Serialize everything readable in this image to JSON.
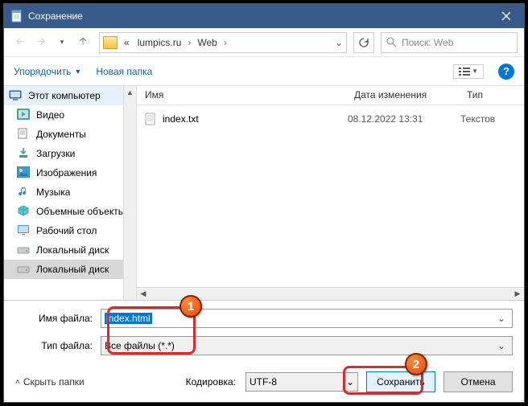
{
  "title": "Сохранение",
  "breadcrumb": {
    "prefix": "«",
    "part1": "lumpics.ru",
    "part2": "Web"
  },
  "search": {
    "placeholder": "Поиск: Web"
  },
  "toolbar": {
    "organize": "Упорядочить",
    "newFolder": "Новая папка"
  },
  "sidebar": {
    "root": "Этот компьютер",
    "items": [
      "Видео",
      "Документы",
      "Загрузки",
      "Изображения",
      "Музыка",
      "Объемные объекты",
      "Рабочий стол",
      "Локальный диск",
      "Локальный диск"
    ]
  },
  "columns": {
    "name": "Имя",
    "date": "Дата изменения",
    "type": "Тип"
  },
  "files": [
    {
      "name": "index.txt",
      "date": "08.12.2022 13:31",
      "type": "Текстов"
    }
  ],
  "labels": {
    "filename": "Имя файла:",
    "filetype": "Тип файла:",
    "encoding": "Кодировка:",
    "hide": "Скрыть папки"
  },
  "values": {
    "filename": "index.html",
    "filetype": "Все файлы  (*.*)",
    "encoding": "UTF-8"
  },
  "buttons": {
    "save": "Сохранить",
    "cancel": "Отмена"
  },
  "badges": {
    "one": "1",
    "two": "2"
  }
}
